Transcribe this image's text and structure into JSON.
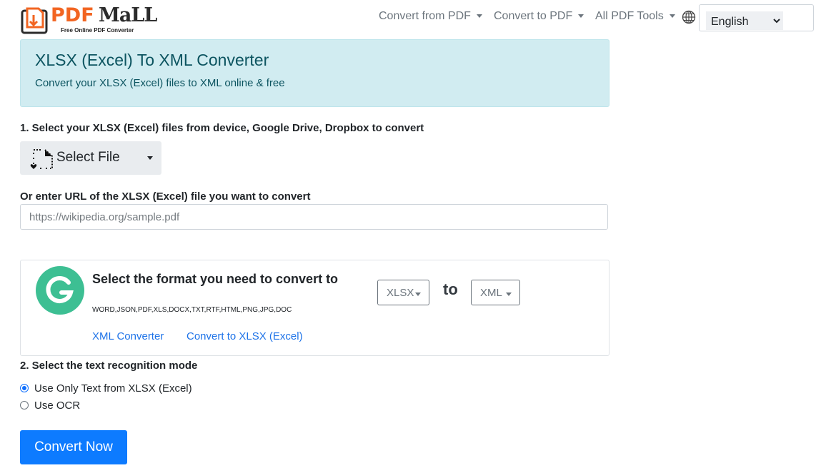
{
  "header": {
    "logo": {
      "brand_pdf": "PDF",
      "brand_mall": "MaLL",
      "tagline": "Free Online PDF Converter"
    },
    "nav": [
      {
        "label": "Convert from PDF"
      },
      {
        "label": "Convert to PDF"
      },
      {
        "label": "All PDF Tools"
      }
    ],
    "language": {
      "selected": "English"
    }
  },
  "alert": {
    "title": "XLSX (Excel) To XML Converter",
    "subtitle": "Convert your XLSX (Excel) files to XML online & free"
  },
  "step1": {
    "label": "1. Select your XLSX (Excel) files from device, Google Drive, Dropbox to convert",
    "select_file_label": "Select File"
  },
  "url": {
    "label": "Or enter URL of the XLSX (Excel) file you want to convert",
    "placeholder": "https://wikipedia.org/sample.pdf",
    "value": ""
  },
  "format": {
    "title": "Select the format you need to convert to",
    "supported": "WORD,JSON,PDF,XLS,DOCX,TXT,RTF,HTML,PNG,JPG,DOC",
    "from": "XLSX",
    "to_word": "to",
    "to": "XML",
    "links": [
      "XML Converter",
      "Convert to XLSX (Excel)"
    ]
  },
  "step2": {
    "label": "2. Select the text recognition mode",
    "options": [
      {
        "label": "Use Only Text from XLSX (Excel)",
        "checked": true
      },
      {
        "label": "Use OCR",
        "checked": false
      }
    ]
  },
  "convert_button": "Convert Now",
  "colors": {
    "accent": "#0d7bff",
    "brand_orange": "#f26522",
    "alert_bg": "#d1ecf1",
    "g_logo": "#3dbf93"
  }
}
